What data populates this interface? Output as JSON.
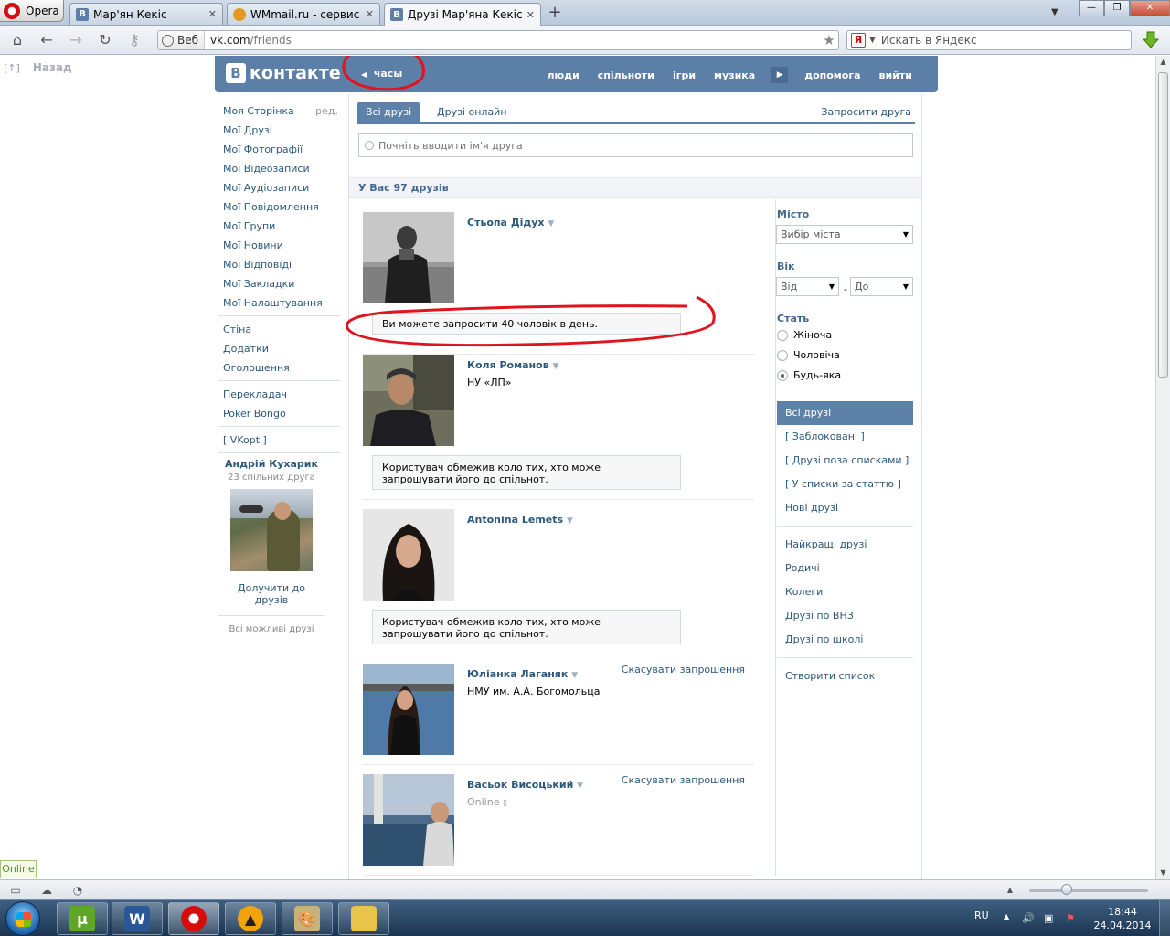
{
  "browser": {
    "opera_label": "Opera",
    "tabs": [
      {
        "title": "Мар'ян Кекіс",
        "favicon": "В",
        "favicon_color": "#5b7fa6"
      },
      {
        "title": "WMmail.ru - сервис п...",
        "favicon": "",
        "favicon_color": "#e39a1f"
      },
      {
        "title": "Друзі Мар'яна Кекіса |...",
        "favicon": "В",
        "favicon_color": "#5b7fa6"
      }
    ],
    "web_label": "Веб",
    "url_host": "vk.com",
    "url_path": "/friends",
    "search_placeholder": "Искать в Яндекс",
    "search_engine": "Я"
  },
  "page": {
    "back_label": "Назад",
    "back_icon": "[↑]"
  },
  "vk_header": {
    "logo_b": "В",
    "logo_text": "контакте",
    "clock_label": "часы",
    "nav": [
      "люди",
      "спільноти",
      "ігри",
      "музика",
      "допомога",
      "вийти"
    ]
  },
  "left_menu": {
    "edit_label": "ред.",
    "items_group1": [
      "Моя Сторінка",
      "Мої Друзі",
      "Мої Фотографії",
      "Мої Відеозаписи",
      "Мої Аудіозаписи",
      "Мої Повідомлення",
      "Мої Групи",
      "Мої Новини",
      "Мої Відповіді",
      "Мої Закладки",
      "Мої Налаштування"
    ],
    "items_group2": [
      "Стіна",
      "Додатки",
      "Оголошення"
    ],
    "items_group3": [
      "Перекладач",
      "Poker Bongo"
    ],
    "items_group4": [
      "[ VKopt ]"
    ]
  },
  "suggest": {
    "name": "Андрій Кухарик",
    "mutual": "23 спільних друга",
    "add_label": "Долучити до друзів",
    "all_label": "Всі можливі друзі"
  },
  "main": {
    "tab_all": "Всі друзі",
    "tab_online": "Друзі онлайн",
    "invite_label": "Запросити друга",
    "search_placeholder": "Почніть вводити ім'я друга",
    "count_label": "У Вас 97 друзів"
  },
  "friends": [
    {
      "name": "Стьопа Дідух",
      "line": "",
      "status": "",
      "action": "",
      "note": "Ви можете запросити 40 чоловік в день."
    },
    {
      "name": "Коля Романов",
      "line": "НУ «ЛП»",
      "status": "",
      "action": "",
      "note": "Користувач обмежив коло тих, хто може запрошувати його до спільнот."
    },
    {
      "name": "Antonina Lemets",
      "line": "",
      "status": "",
      "action": "",
      "note": "Користувач обмежив коло тих, хто може запрошувати його до спільнот."
    },
    {
      "name": "Юліанка Лаганяк",
      "line": "НМУ им. А.А. Богомольца",
      "status": "",
      "action": "Скасувати запрошення",
      "note": ""
    },
    {
      "name": "Васьок Висоцький",
      "line": "",
      "status": "Online",
      "action": "Скасувати запрошення",
      "note": ""
    }
  ],
  "filters": {
    "city_label": "Місто",
    "city_value": "Вибір міста",
    "age_label": "Вік",
    "age_from": "Від",
    "age_to": "До",
    "age_dash": "-",
    "sex_label": "Стать",
    "sex_options": [
      "Жіноча",
      "Чоловіча",
      "Будь-яка"
    ],
    "sex_selected": "Будь-яка",
    "lists_group1": [
      "Всі друзі",
      "[ Заблоковані ]",
      "[ Друзі поза списками ]",
      "[ У списки за статтю ]",
      "Нові друзі"
    ],
    "lists_group2": [
      "Найкращі друзі",
      "Родичі",
      "Колеги",
      "Друзі по ВНЗ",
      "Друзі по школі"
    ],
    "create_list": "Створити список"
  },
  "statusbar": {
    "online_badge": "Online"
  },
  "taskbar": {
    "lang": "RU",
    "time": "18:44",
    "date": "24.04.2014"
  },
  "colors": {
    "vk_blue": "#5b7fa6",
    "vk_link": "#2b587a",
    "annotation_red": "#e0141e"
  }
}
